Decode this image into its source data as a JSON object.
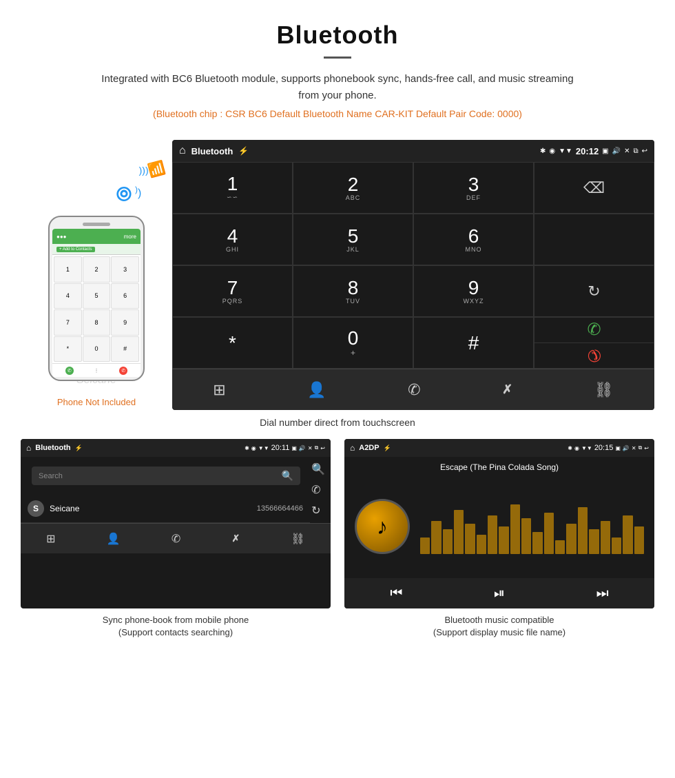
{
  "header": {
    "title": "Bluetooth",
    "description": "Integrated with BC6 Bluetooth module, supports phonebook sync, hands-free call, and music streaming from your phone.",
    "spec": "(Bluetooth chip : CSR BC6    Default Bluetooth Name CAR-KIT    Default Pair Code: 0000)"
  },
  "phone_note": "Phone Not Included",
  "main_screen": {
    "status": {
      "left_icon": "⌂",
      "title": "Bluetooth",
      "usb_icon": "⚡",
      "bt_icon": "*",
      "location_icon": "◉",
      "signal_icon": "▼",
      "time": "20:12",
      "camera_icon": "📷",
      "volume_icon": "🔊",
      "close_icon": "✕",
      "window_icon": "⧉",
      "back_icon": "↩"
    },
    "dialpad": [
      {
        "num": "1",
        "letters": "∽∽",
        "row": 0,
        "col": 0
      },
      {
        "num": "2",
        "letters": "ABC",
        "row": 0,
        "col": 1
      },
      {
        "num": "3",
        "letters": "DEF",
        "row": 0,
        "col": 2
      },
      {
        "num": "4",
        "letters": "GHI",
        "row": 1,
        "col": 0
      },
      {
        "num": "5",
        "letters": "JKL",
        "row": 1,
        "col": 1
      },
      {
        "num": "6",
        "letters": "MNO",
        "row": 1,
        "col": 2
      },
      {
        "num": "7",
        "letters": "PQRS",
        "row": 2,
        "col": 0
      },
      {
        "num": "8",
        "letters": "TUV",
        "row": 2,
        "col": 1
      },
      {
        "num": "9",
        "letters": "WXYZ",
        "row": 2,
        "col": 2
      },
      {
        "num": "*",
        "letters": "",
        "row": 3,
        "col": 0
      },
      {
        "num": "0",
        "letters": "+",
        "row": 3,
        "col": 1
      },
      {
        "num": "#",
        "letters": "",
        "row": 3,
        "col": 2
      }
    ],
    "caption": "Dial number direct from touchscreen"
  },
  "phonebook_screen": {
    "status_title": "Bluetooth",
    "time": "20:11",
    "search_placeholder": "Search",
    "contact": {
      "initial": "S",
      "name": "Seicane",
      "number": "13566664466"
    },
    "caption_line1": "Sync phone-book from mobile phone",
    "caption_line2": "(Support contacts searching)"
  },
  "music_screen": {
    "status_title": "A2DP",
    "time": "20:15",
    "song_title": "Escape (The Pina Colada Song)",
    "music_note": "♪",
    "caption_line1": "Bluetooth music compatible",
    "caption_line2": "(Support display music file name)"
  },
  "icons": {
    "home": "⌂",
    "back": "⬅",
    "dialpad": "⊞",
    "person": "👤",
    "phone": "📞",
    "bluetooth": "Ƀ",
    "link": "🔗",
    "search": "🔍",
    "call_green": "📞",
    "call_red": "📞",
    "rewind": "⏮",
    "play_pause": "⏯",
    "forward": "⏭"
  }
}
